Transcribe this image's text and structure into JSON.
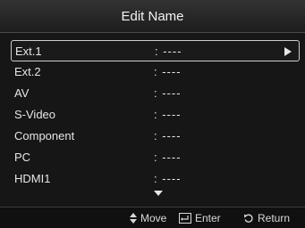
{
  "header": {
    "title": "Edit Name"
  },
  "list": {
    "items": [
      {
        "label": "Ext.1",
        "value": ": ----",
        "selected": true
      },
      {
        "label": "Ext.2",
        "value": ": ----"
      },
      {
        "label": "AV",
        "value": ": ----"
      },
      {
        "label": "S-Video",
        "value": ": ----"
      },
      {
        "label": "Component",
        "value": ": ----"
      },
      {
        "label": "PC",
        "value": ": ----"
      },
      {
        "label": "HDMI1",
        "value": ": ----"
      }
    ]
  },
  "footer": {
    "move_label": "Move",
    "enter_label": "Enter",
    "return_label": "Return"
  },
  "icons": {
    "move": "up-down-arrows-icon",
    "enter": "enter-icon",
    "return": "return-icon",
    "selected_arrow": "arrow-right-icon",
    "more": "arrow-down-icon"
  }
}
